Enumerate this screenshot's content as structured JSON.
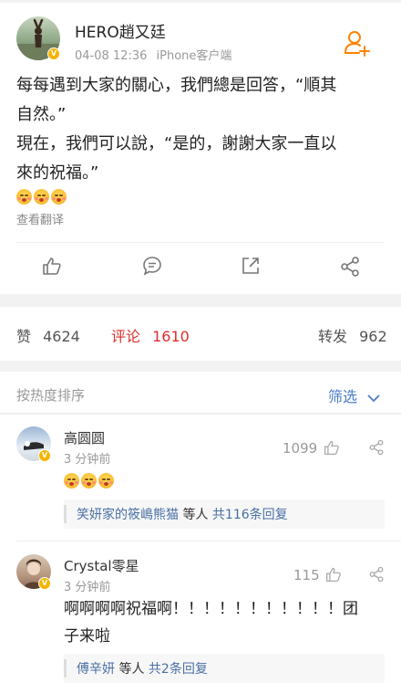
{
  "post": {
    "author": "HERO趙又廷",
    "date": "04-08 12:36",
    "source": "iPhone客户端",
    "text_lines": [
      "每每遇到大家的關心，我們總是回答，“順其",
      "自然。”",
      "現在，我們可以說，“是的，謝謝大家一直以",
      "來的祝福。”"
    ],
    "translate_label": "查看翻译"
  },
  "stats": {
    "likes_label": "赞",
    "likes_count": "4624",
    "comments_label": "评论",
    "comments_count": "1610",
    "reposts_label": "转发",
    "reposts_count": "962"
  },
  "comments_header": {
    "sort_label": "按热度排序",
    "filter_label": "筛选"
  },
  "comments": [
    {
      "name": "高圆圆",
      "time": "3 分钟前",
      "likes": "1099",
      "replies_user": "笑妍家的筱嶋熊猫",
      "replies_etc": " 等人 ",
      "replies_count_label": "共116条回复"
    },
    {
      "name": "Crystal零星",
      "time": "3 分钟前",
      "likes": "115",
      "text_lines": [
        "啊啊啊啊祝福啊！！！！！！！！！！！团",
        "子来啦"
      ],
      "replies_user": "傅辛妍",
      "replies_etc": " 等人 ",
      "replies_count_label": "共2条回复"
    }
  ],
  "colors": {
    "accent_orange": "#ff8200",
    "active_red": "#e02d2d",
    "link_blue": "#4a6fa5",
    "verified_gold": "#f5b400"
  }
}
